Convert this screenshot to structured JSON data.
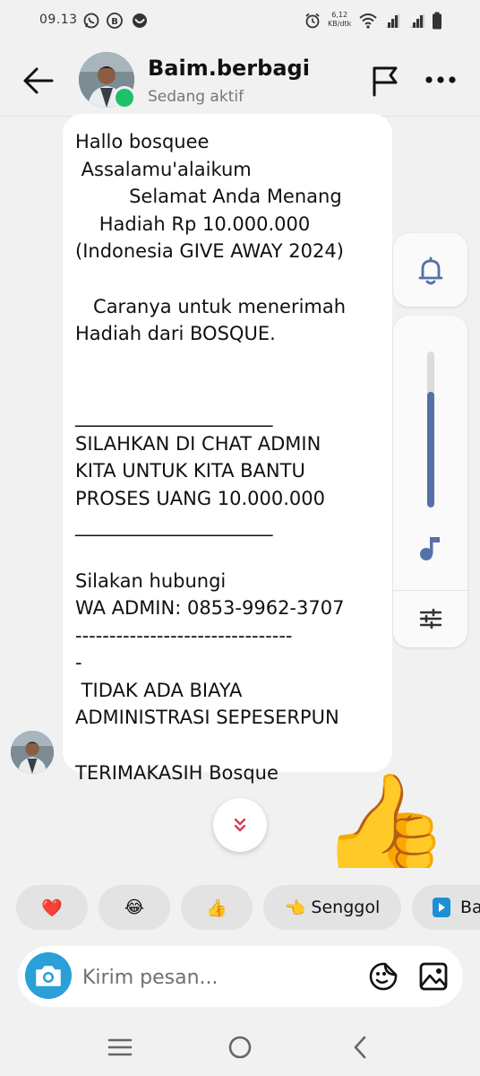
{
  "status_bar": {
    "time": "09.13",
    "net_speed_value": "6,12",
    "net_speed_unit": "KB/dtk",
    "notif_icons": [
      "whatsapp-icon",
      "b-app-icon",
      "heart-shield-icon"
    ],
    "system_icons": [
      "alarm-icon",
      "wifi-icon",
      "signal-icon",
      "signal-icon",
      "battery-icon"
    ]
  },
  "header": {
    "name": "Baim.berbagi",
    "status": "Sedang aktif",
    "online_color": "#1ec16a",
    "icons": [
      "back-arrow-icon",
      "flag-icon",
      "more-icon"
    ]
  },
  "message": {
    "text": "Hallo bosquee\n Assalamu'alaikum\n         Selamat Anda Menang\n    Hadiah Rp 10.000.000\n(Indonesia GIVE AWAY 2024)\n\n   Caranya untuk menerimah\nHadiah dari BOSQUE.\n\n\n_____________________\nSILAHKAN DI CHAT ADMIN\nKITA UNTUK KITA BANTU\nPROSES UANG 10.000.000\n_____________________\n\nSilakan hubungi\nWA ADMIN: 0853-9962-3707\n--------------------------------\n-\n TIDAK ADA BIAYA\nADMINISTRASI SEPESERPUN\n\nTERIMAKASIH Bosque"
  },
  "volume_panel": {
    "level": 0.74,
    "accent": "#5670a8",
    "icons": [
      "bell-icon",
      "music-note-icon",
      "equalizer-icon"
    ]
  },
  "big_emoji": "👍",
  "scroll_down_icon": "double-chevron-down-icon",
  "quick_replies": [
    {
      "emoji": "❤️",
      "label": ""
    },
    {
      "emoji": "😂",
      "label": ""
    },
    {
      "emoji": "👍",
      "label": ""
    },
    {
      "emoji": "👈",
      "label": "Senggol"
    },
    {
      "emoji": "",
      "label": "Ba"
    }
  ],
  "composer": {
    "placeholder": "Kirim pesan...",
    "camera_color": "#2a9fd8",
    "icons": [
      "camera-icon",
      "sticker-icon",
      "gallery-icon"
    ]
  },
  "nav_bar": {
    "icons": [
      "recent-apps-icon",
      "home-icon",
      "back-icon"
    ]
  }
}
